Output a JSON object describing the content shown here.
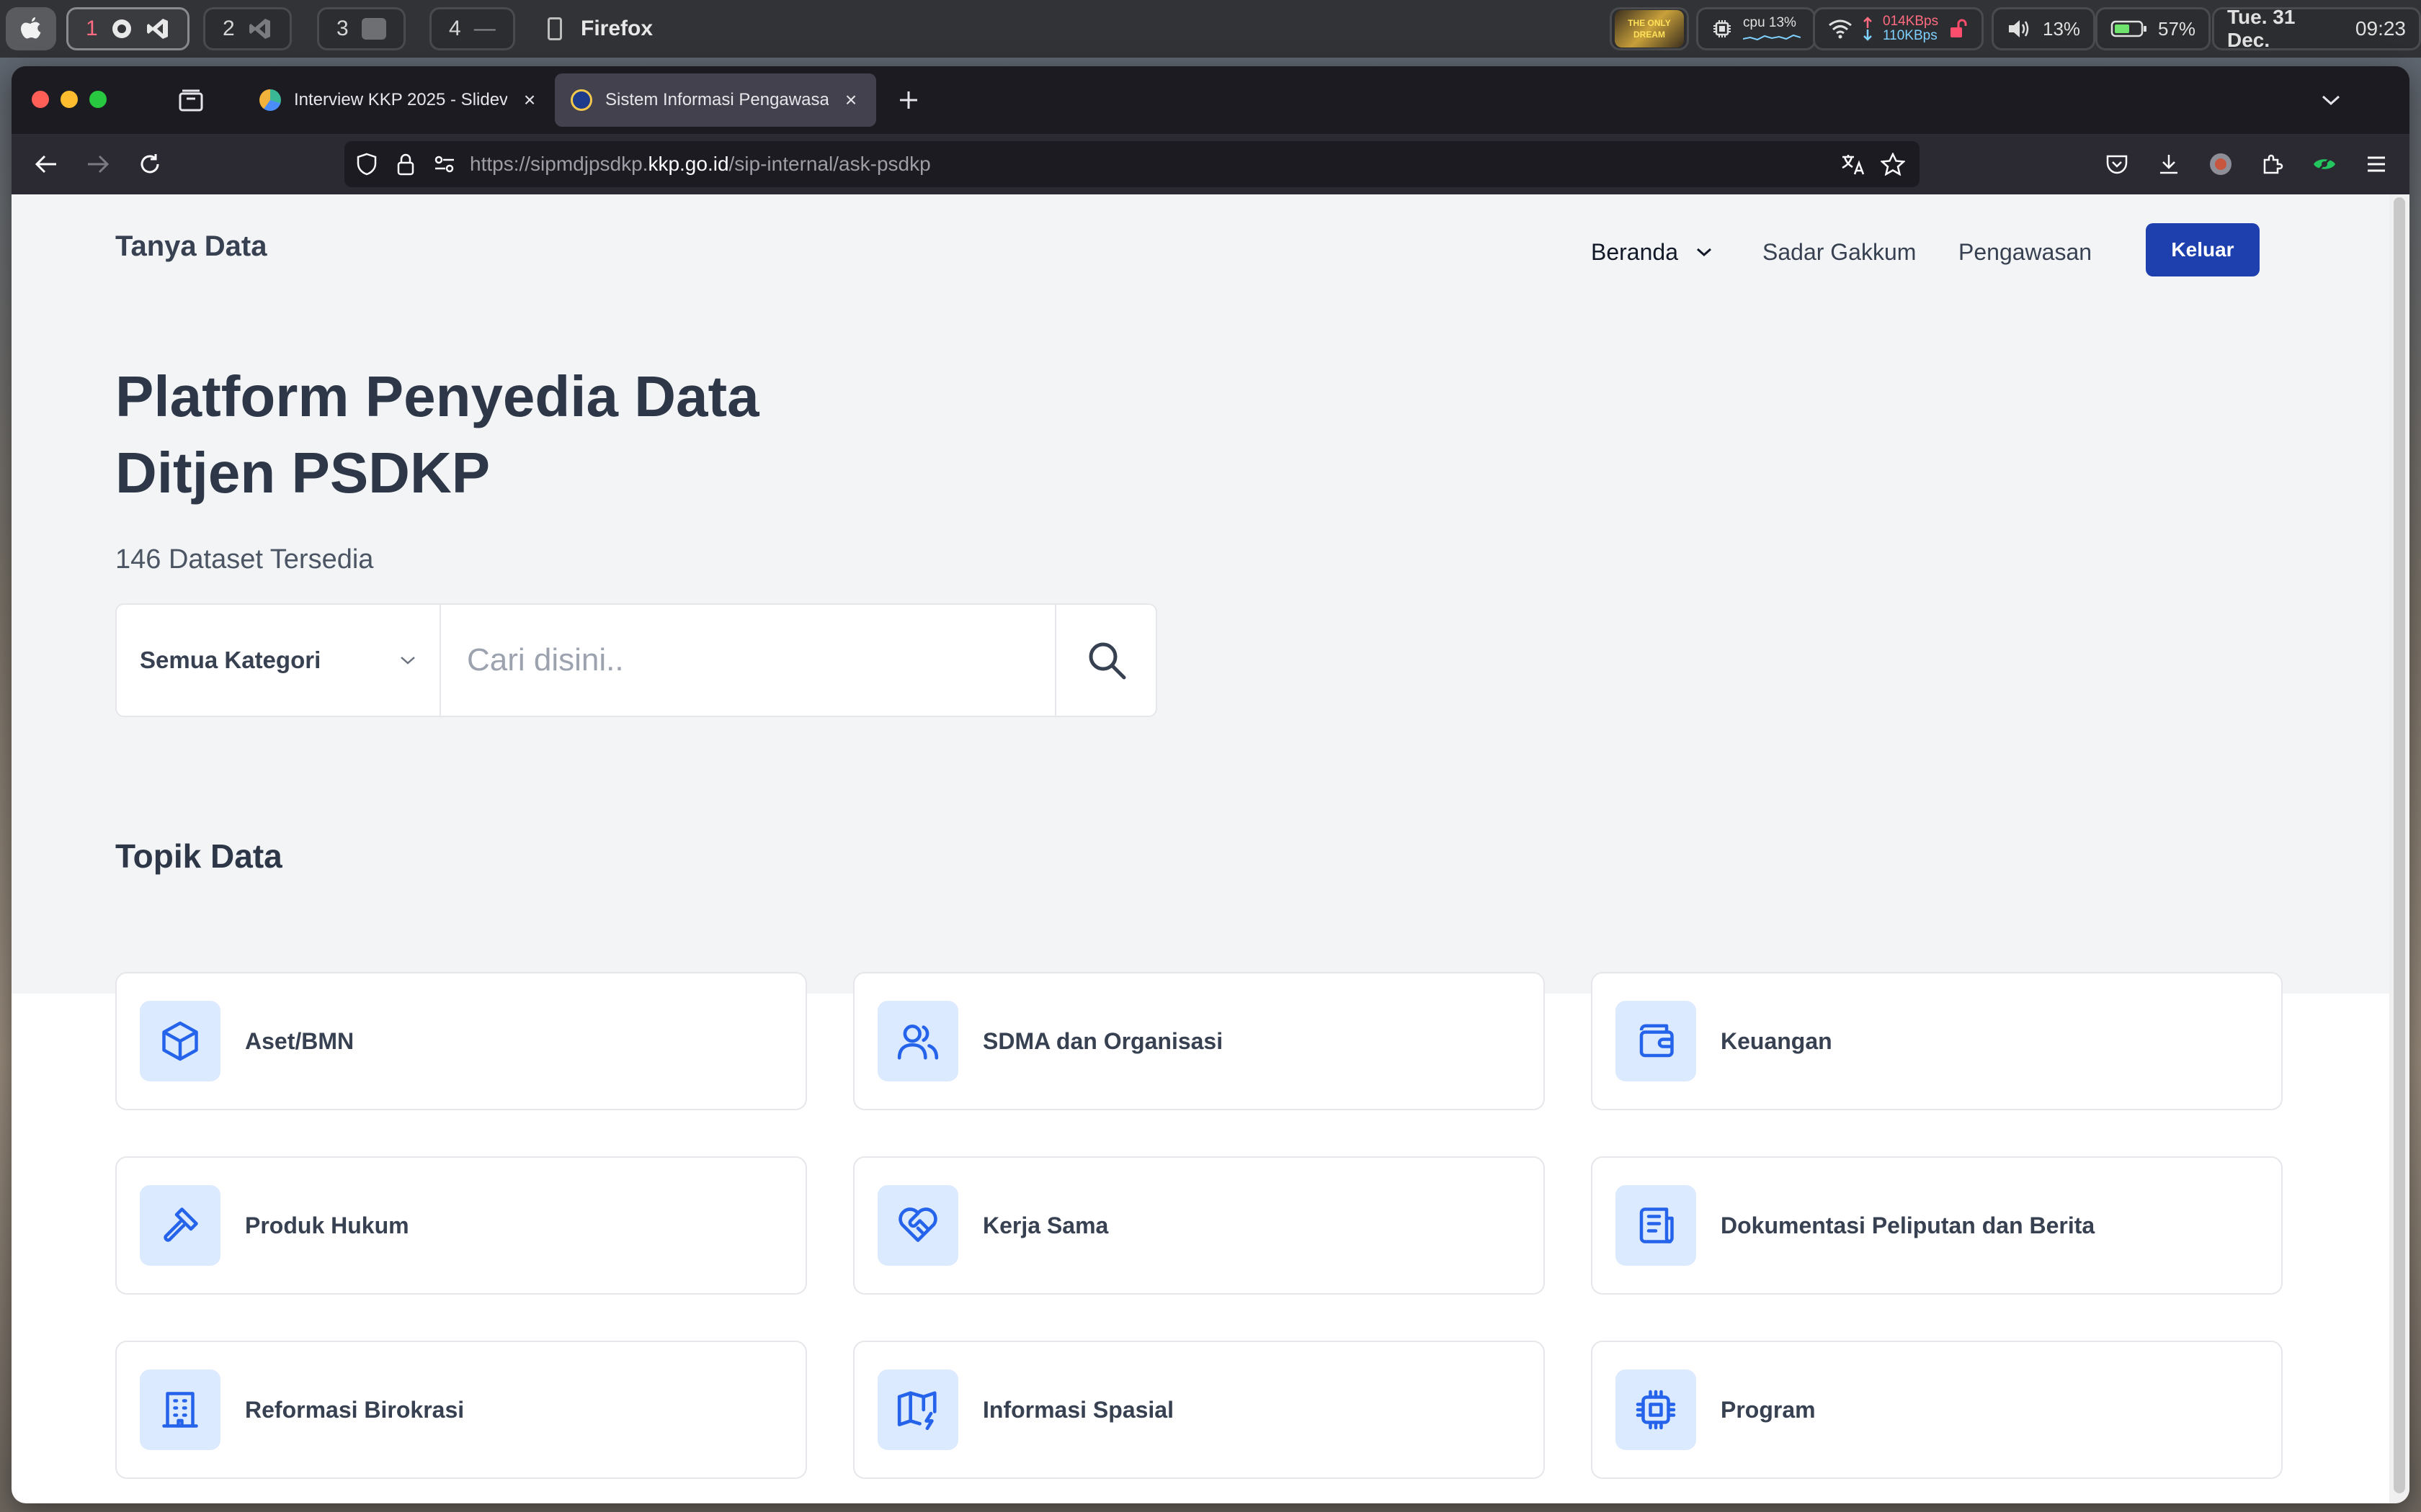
{
  "menubar": {
    "workspaces": [
      {
        "num": "1",
        "active": true
      },
      {
        "num": "2",
        "active": false
      },
      {
        "num": "3",
        "active": false
      },
      {
        "num": "4",
        "active": false
      }
    ],
    "app_name": "Firefox",
    "cpu_label": "cpu 13%",
    "net_up": "014KBps",
    "net_down": "110KBps",
    "volume": "13%",
    "battery": "57%",
    "date": "Tue. 31 Dec.",
    "time": "09:23",
    "thumb_text": "THE ONLY DREAM"
  },
  "browser": {
    "tabs": [
      {
        "title": "Interview KKP 2025 - Slidev",
        "selected": false
      },
      {
        "title": "Sistem Informasi Pengawasan -",
        "selected": true
      }
    ],
    "url_prefix": "https://sipmdjpsdkp.",
    "url_host": "kkp.go.id",
    "url_path": "/sip-internal/ask-psdkp"
  },
  "page": {
    "brand": "Tanya Data",
    "nav": {
      "home": "Beranda",
      "sadar_gakkum": "Sadar Gakkum",
      "pengawasan": "Pengawasan",
      "logout": "Keluar"
    },
    "hero": {
      "title_line1": "Platform Penyedia Data",
      "title_line2": "Ditjen PSDKP",
      "dataset_count": "146 Dataset Tersedia"
    },
    "search": {
      "category": "Semua Kategori",
      "placeholder": "Cari disini.."
    },
    "topics": {
      "title": "Topik Data",
      "items": [
        {
          "label": "Aset/BMN",
          "icon": "cube-icon"
        },
        {
          "label": "SDMA dan Organisasi",
          "icon": "users-icon"
        },
        {
          "label": "Keuangan",
          "icon": "wallet-icon"
        },
        {
          "label": "Produk Hukum",
          "icon": "gavel-icon"
        },
        {
          "label": "Kerja Sama",
          "icon": "handshake-heart-icon"
        },
        {
          "label": "Dokumentasi Peliputan dan Berita",
          "icon": "newspaper-icon"
        },
        {
          "label": "Reformasi Birokrasi",
          "icon": "building-icon"
        },
        {
          "label": "Informasi Spasial",
          "icon": "map-icon"
        },
        {
          "label": "Program",
          "icon": "chip-icon"
        }
      ]
    }
  },
  "colors": {
    "accent": "#1e40af",
    "icon_blue": "#2563eb",
    "icon_bg": "#dbeafe",
    "heading": "#2d3748"
  }
}
